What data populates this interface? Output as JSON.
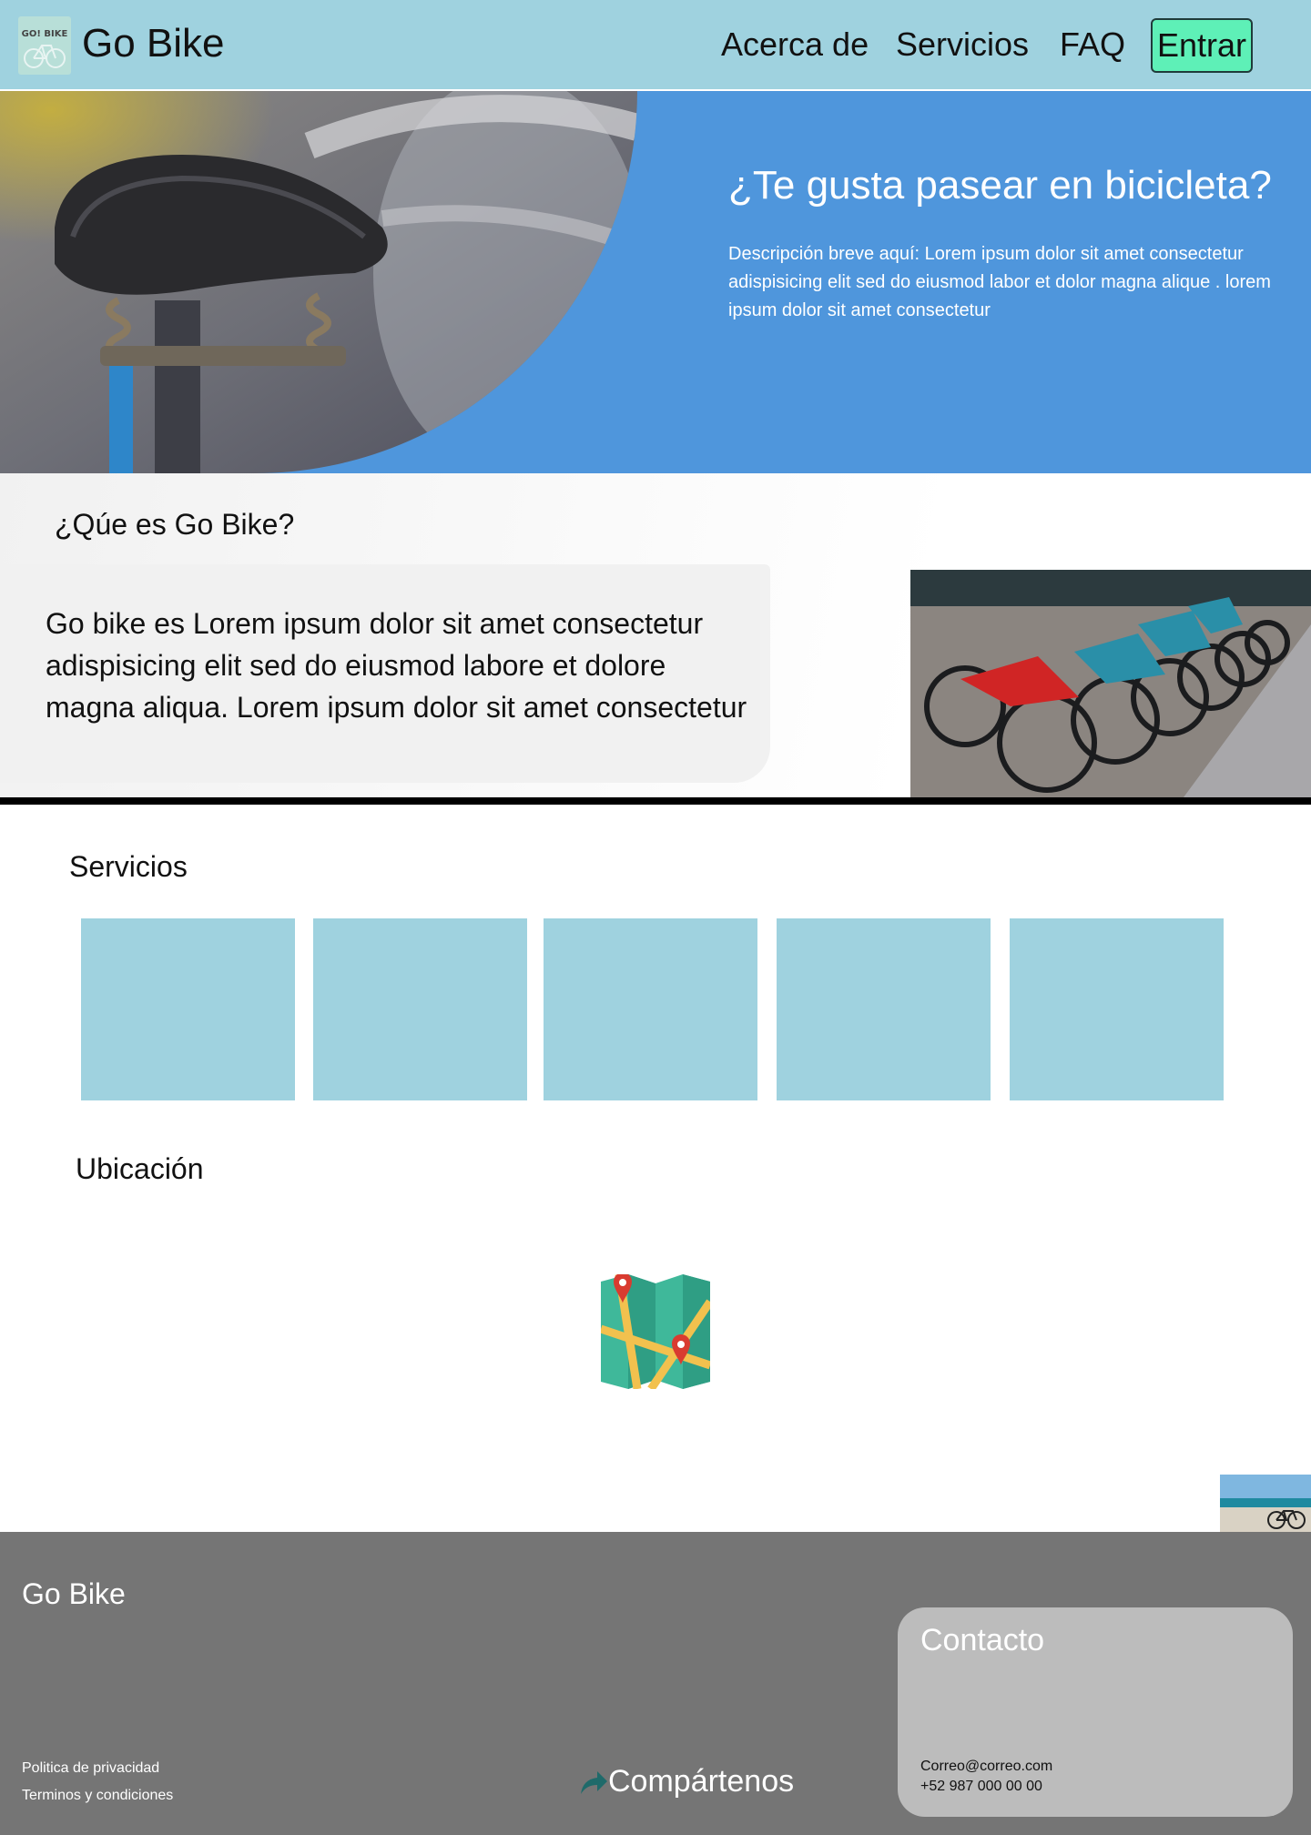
{
  "header": {
    "logo_text": "GO! BIKE",
    "brand": "Go Bike",
    "nav": {
      "about": "Acerca de",
      "services": "Servicios",
      "faq": "FAQ"
    },
    "login_label": "Entrar"
  },
  "hero": {
    "title": "¿Te gusta pasear en bicicleta?",
    "description": "Descripción breve aquí: Lorem ipsum dolor sit amet consectetur adispisicing elit sed do eiusmod labor et dolor magna alique . lorem ipsum dolor sit amet consectetur"
  },
  "about": {
    "title": "¿Qúe es Go Bike?",
    "text": "Go bike es Lorem ipsum dolor sit amet consectetur adispisicing elit sed do eiusmod labore et dolore magna aliqua. Lorem ipsum dolor sit amet consectetur"
  },
  "services": {
    "title": "Servicios",
    "card_count": 5
  },
  "location": {
    "title": "Ubicación",
    "icon": "map-icon"
  },
  "footer": {
    "brand": "Go Bike",
    "privacy": "Politica de privacidad",
    "terms": "Terminos y condiciones",
    "share_label": "Compártenos",
    "contact": {
      "title": "Contacto",
      "email": "Correo@correo.com",
      "phone": "+52 987 000 00 00"
    }
  },
  "colors": {
    "header_bg": "#9fd2df",
    "hero_bg": "#4f96dc",
    "login_button": "#5ef0b7",
    "service_card": "#9fd2df",
    "footer_bg": "#757575",
    "contact_card": "#bcbcbc"
  }
}
